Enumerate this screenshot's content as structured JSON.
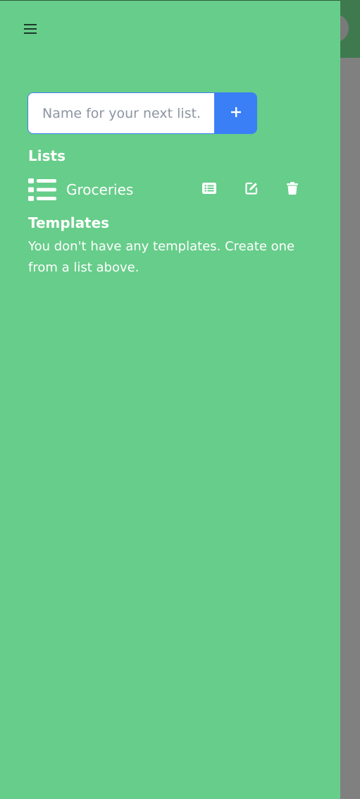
{
  "colors": {
    "drawer_background": "#67cd8a",
    "accent": "#3b7ff6",
    "text": "#ffffff",
    "overlay": "#808080"
  },
  "header": {
    "menu_icon": "hamburger-menu-icon"
  },
  "new_list": {
    "placeholder": "Name for your next list...",
    "value": "",
    "add_icon": "plus-icon"
  },
  "lists": {
    "title": "Lists",
    "items": [
      {
        "name": "Groceries",
        "icon": "list-icon",
        "actions": [
          "list-details-icon",
          "edit-icon",
          "trash-icon"
        ]
      }
    ]
  },
  "templates": {
    "title": "Templates",
    "empty_text": "You don't have any templates. Create one from a list above."
  }
}
